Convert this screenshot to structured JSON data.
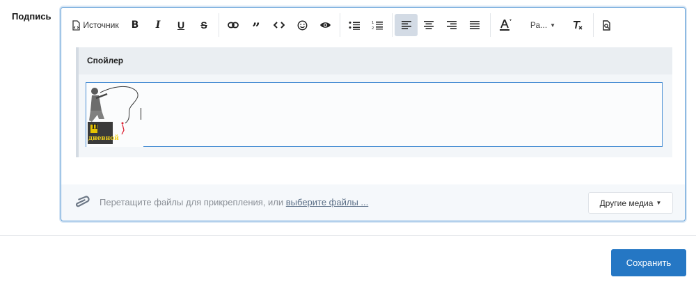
{
  "field": {
    "label": "Подпись"
  },
  "toolbar": {
    "source_label": "Источник",
    "font_size_label": "Ра..."
  },
  "spoiler": {
    "title": "Спойлер"
  },
  "image": {
    "caption": "дневной",
    "badge": "II"
  },
  "attach": {
    "text": "Перетащите файлы для прикрепления, или ",
    "link": "выберите файлы ..."
  },
  "media": {
    "label": "Другие медиа"
  },
  "actions": {
    "save_label": "Сохранить"
  },
  "colors": {
    "accent": "#2577c4",
    "focus_border": "#4a8fd4"
  }
}
